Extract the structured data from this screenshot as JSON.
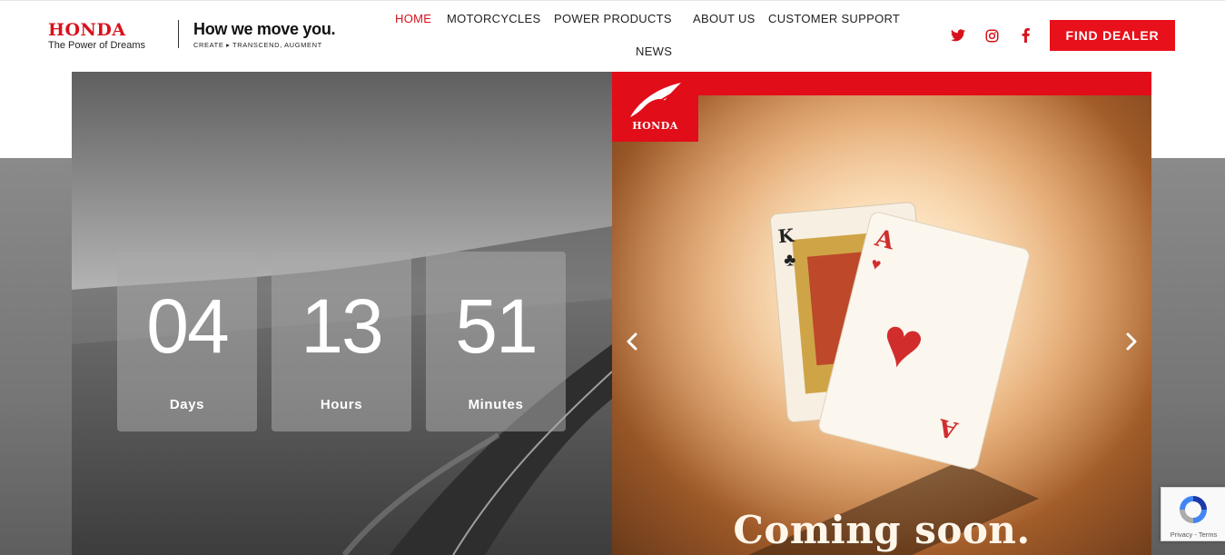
{
  "header": {
    "brand_name": "HONDA",
    "brand_tagline": "The Power of Dreams",
    "slogan": "How we move you.",
    "slogan_sub": "CREATE ▸ TRANSCEND, AUGMENT",
    "nav": [
      {
        "label": "HOME",
        "active": true
      },
      {
        "label": "MOTORCYCLES",
        "active": false
      },
      {
        "label": "POWER PRODUCTS",
        "active": false
      },
      {
        "label": "ABOUT US",
        "active": false
      },
      {
        "label": "CUSTOMER SUPPORT",
        "active": false
      },
      {
        "label": "NEWS",
        "active": false
      }
    ],
    "social": [
      "twitter-icon",
      "instagram-icon",
      "facebook-icon"
    ],
    "find_dealer": "FIND DEALER"
  },
  "countdown": [
    {
      "value": "04",
      "label": "Days"
    },
    {
      "value": "13",
      "label": "Hours"
    },
    {
      "value": "51",
      "label": "Minutes"
    }
  ],
  "promo": {
    "badge_text": "HONDA",
    "headline": "Coming soon.",
    "card_king_rank": "K",
    "card_ace_rank": "A"
  },
  "recaptcha": {
    "text": "Privacy - Terms"
  },
  "colors": {
    "accent": "#e8101a",
    "nav_active": "#d8121c"
  }
}
